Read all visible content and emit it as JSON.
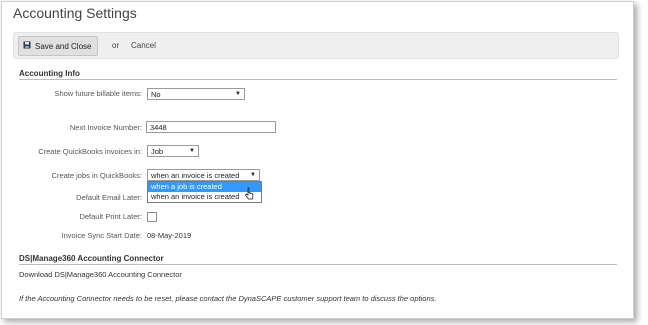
{
  "window": {
    "title": "Accounting Settings"
  },
  "toolbar": {
    "save_label": "Save and Close",
    "or_label": "or",
    "cancel_label": "Cancel"
  },
  "accounting_info": {
    "heading": "Accounting Info",
    "future_billable": {
      "label": "Show future billable items:",
      "value": "No"
    },
    "next_invoice": {
      "label": "Next Invoice Number:",
      "value": "3448"
    },
    "create_invoices_in": {
      "label": "Create QuickBooks invoices in:",
      "value": "Job"
    },
    "create_jobs_in": {
      "label": "Create jobs in QuickBooks:",
      "value": "when an invoice is created",
      "options": [
        "when a job is created",
        "when an invoice is created"
      ],
      "highlighted_index": 0
    },
    "default_email_later": {
      "label": "Default Email Later:"
    },
    "default_print_later": {
      "label": "Default Print Later:"
    },
    "invoice_sync_start": {
      "label": "Invoice Sync Start Date:",
      "value": "08-May-2019"
    }
  },
  "connector": {
    "heading": "DS|Manage360 Accounting Connector",
    "download_link": "Download DS|Manage360 Accounting Connector",
    "note": "If the Accounting Connector needs to be reset, please contact the DynaSCAPE customer support team to discuss the options."
  }
}
